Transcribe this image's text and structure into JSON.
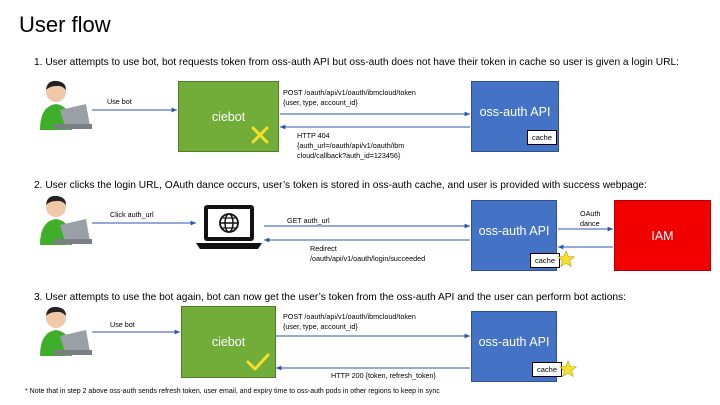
{
  "title": "User flow",
  "steps": {
    "s1": "1. User attempts to use bot, bot requests token from oss-auth API but oss-auth does not have their token in cache so user is given a login URL:",
    "s2": "2. User clicks the login URL, OAuth dance occurs, user’s token is stored in oss-auth cache, and user is provided with success webpage:",
    "s3": "3. User attempts to use the bot again, bot can now get the user’s token from the oss-auth API and the user can perform bot actions:"
  },
  "nodes": {
    "ciebot": "ciebot",
    "api": "oss-auth API",
    "cache": "cache",
    "iam": "IAM"
  },
  "flow1": {
    "use_bot": "Use bot",
    "post_line1": "POST /oauth/api/v1/oauth/ibmcloud/token",
    "post_line2": "{user, type, account_id}",
    "resp_line1": "HTTP 404",
    "resp_line2": "{auth_url=/oauth/api/v1/oauth/ibm",
    "resp_line3": "cloud/callback?auth_id=123456}"
  },
  "flow2": {
    "click": "Click auth_url",
    "get": "GET auth_url",
    "redirect_line1": "Redirect",
    "redirect_line2": "/oauth/api/v1/oauth/login/succeeded",
    "oauth_line1": "OAuth",
    "oauth_line2": "dance"
  },
  "flow3": {
    "use_bot": "Use bot",
    "post_line1": "POST /oauth/api/v1/oauth/ibmcloud/token",
    "post_line2": "{user, type, account_id}",
    "resp": "HTTP 200 {token, refresh_token}"
  },
  "note": "* Note that in step 2 above oss-auth sends refresh token, user email, and expiry time to oss-auth pods in other regions to keep in sync",
  "icons": [
    "user-icon",
    "x-mark-icon",
    "laptop-globe-icon",
    "star-icon",
    "checkmark-icon"
  ],
  "colors": {
    "ciebot": "#72ad3a",
    "api": "#4473c5",
    "iam": "#f20000",
    "x_mark": "#f5e12a",
    "star": "#f5e12a",
    "checkmark": "#f5e12a"
  }
}
